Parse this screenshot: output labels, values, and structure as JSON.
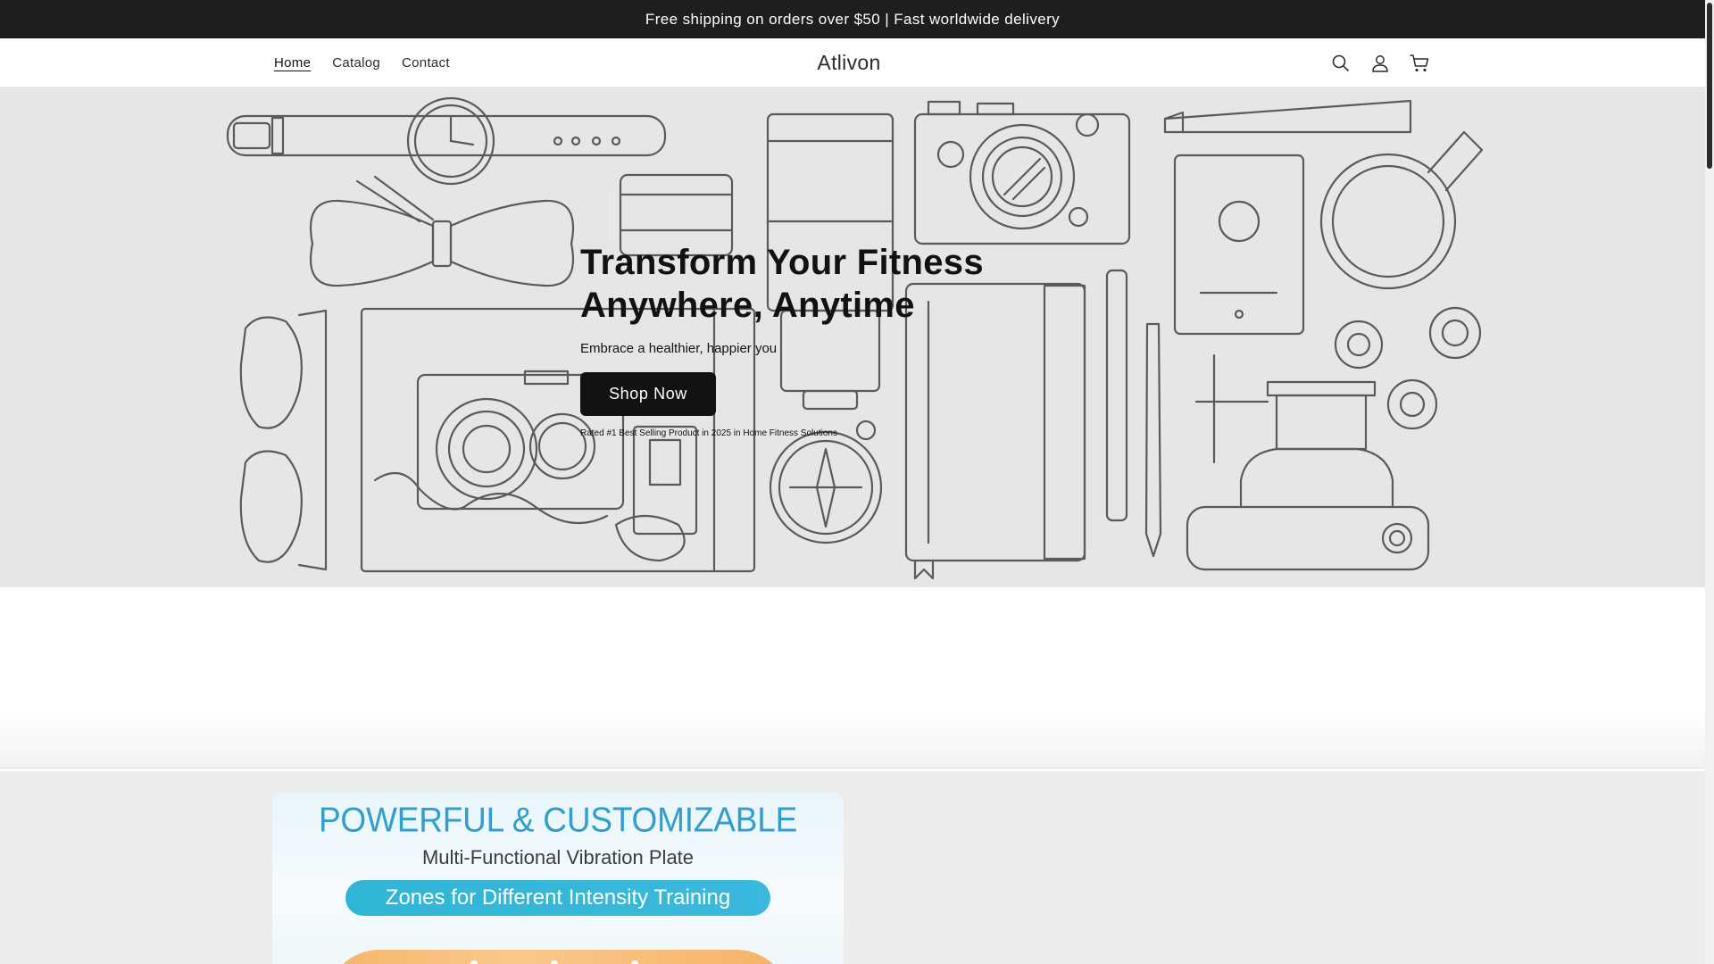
{
  "announcement": {
    "text": "Free shipping on orders over $50 | Fast worldwide delivery"
  },
  "header": {
    "nav": [
      {
        "label": "Home",
        "active": true
      },
      {
        "label": "Catalog",
        "active": false
      },
      {
        "label": "Contact",
        "active": false
      }
    ],
    "logo": "Atlivon",
    "icons": [
      "search-icon",
      "account-icon",
      "cart-icon"
    ]
  },
  "hero": {
    "title_line1": "Transform Your Fitness",
    "title_line2": "Anywhere, Anytime",
    "subtitle": "Embrace a healthier, happier you",
    "button_label": "Shop Now",
    "rated_text": "Rated #1 Best Selling Product in 2025 in Home Fitness Solutions",
    "background_color": "#e6e6e6"
  },
  "product_media": {
    "title": "POWERFUL & CUSTOMIZABLE",
    "subtitle": "Multi-Functional Vibration Plate",
    "pill_text": "Zones for Different Intensity Training",
    "title_color": "#2e9fd0",
    "pill_color": "#2fb6d6"
  },
  "colors": {
    "accent": "#121212",
    "announcement_bg": "#1e1e1e"
  }
}
